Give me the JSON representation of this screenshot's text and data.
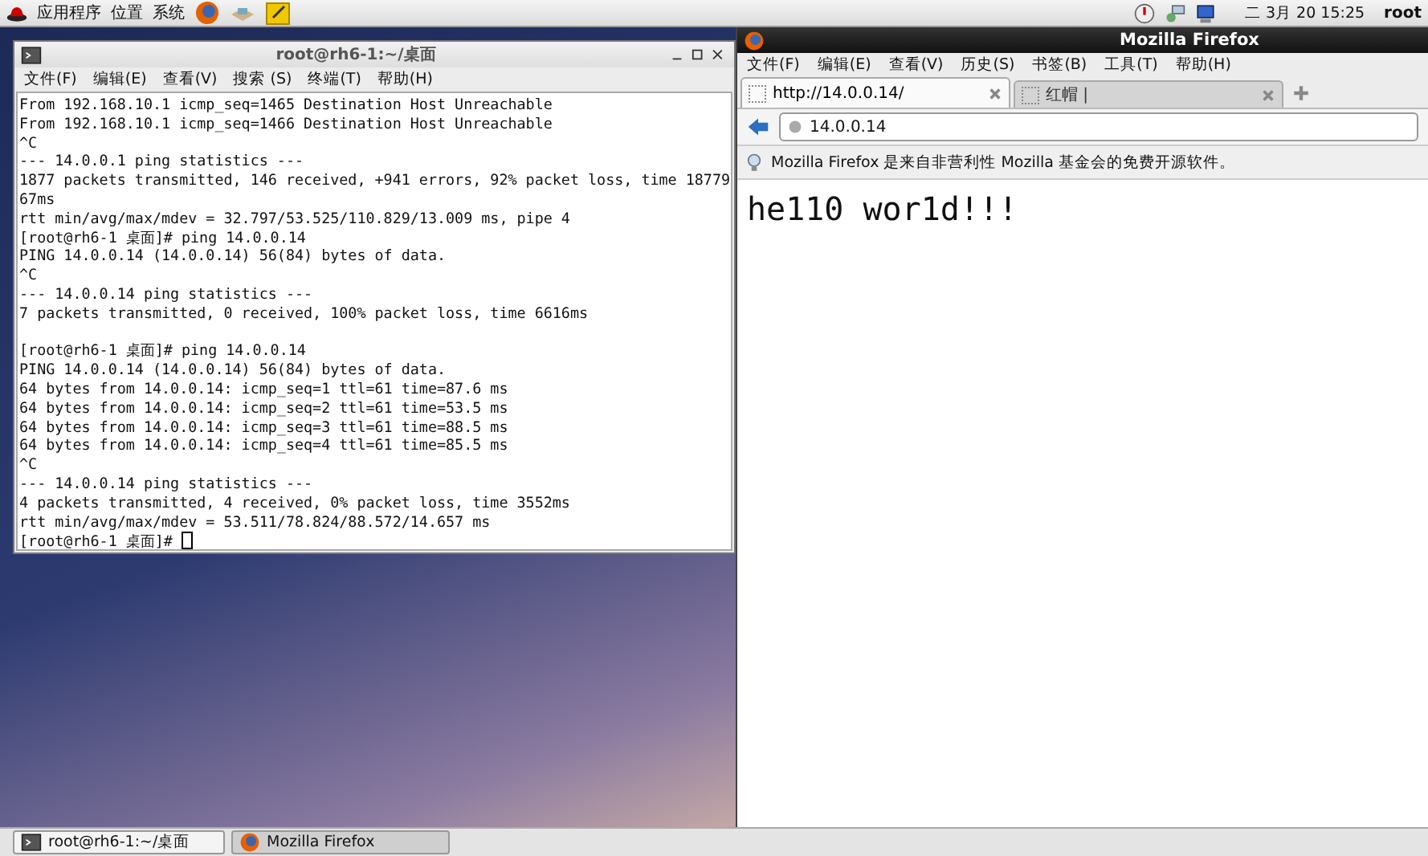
{
  "top_panel": {
    "menus": [
      "应用程序",
      "位置",
      "系统"
    ],
    "clock": "二 3月 20 15:25",
    "user": "root"
  },
  "terminal": {
    "title": "root@rh6-1:~/桌面",
    "menu": [
      "文件(F)",
      "编辑(E)",
      "查看(V)",
      "搜索 (S)",
      "终端(T)",
      "帮助(H)"
    ],
    "blocks": [
      [
        "From 192.168.10.1 icmp_seq=1465 Destination Host Unreachable",
        "From 192.168.10.1 icmp_seq=1466 Destination Host Unreachable",
        "^C",
        "--- 14.0.0.1 ping statistics ---",
        "1877 packets transmitted, 146 received, +941 errors, 92% packet loss, time 18779",
        "67ms",
        "rtt min/avg/max/mdev = 32.797/53.525/110.829/13.009 ms, pipe 4",
        "[root@rh6-1 桌面]# ping 14.0.0.14",
        "PING 14.0.0.14 (14.0.0.14) 56(84) bytes of data.",
        "^C",
        "--- 14.0.0.14 ping statistics ---",
        "7 packets transmitted, 0 received, 100% packet loss, time 6616ms"
      ],
      [
        "[root@rh6-1 桌面]# ping 14.0.0.14",
        "PING 14.0.0.14 (14.0.0.14) 56(84) bytes of data.",
        "64 bytes from 14.0.0.14: icmp_seq=1 ttl=61 time=87.6 ms",
        "64 bytes from 14.0.0.14: icmp_seq=2 ttl=61 time=53.5 ms",
        "64 bytes from 14.0.0.14: icmp_seq=3 ttl=61 time=88.5 ms",
        "64 bytes from 14.0.0.14: icmp_seq=4 ttl=61 time=85.5 ms",
        "^C",
        "--- 14.0.0.14 ping statistics ---",
        "4 packets transmitted, 4 received, 0% packet loss, time 3552ms",
        "rtt min/avg/max/mdev = 53.511/78.824/88.572/14.657 ms"
      ]
    ],
    "prompt": "[root@rh6-1 桌面]#"
  },
  "firefox": {
    "title": "Mozilla Firefox",
    "menu": [
      "文件(F)",
      "编辑(E)",
      "查看(V)",
      "历史(S)",
      "书签(B)",
      "工具(T)",
      "帮助(H)"
    ],
    "tabs": [
      {
        "label": "http://14.0.0.14/",
        "selected": true
      },
      {
        "label": "红帽 |",
        "selected": false
      }
    ],
    "address": "14.0.0.14",
    "notice": "Mozilla Firefox 是来自非营利性 Mozilla 基金会的免费开源软件。",
    "page_text": "he110 wor1d!!!"
  },
  "taskbar": [
    {
      "label": "root@rh6-1:~/桌面",
      "kind": "terminal",
      "selected": false
    },
    {
      "label": "Mozilla Firefox",
      "kind": "firefox",
      "selected": true
    }
  ]
}
